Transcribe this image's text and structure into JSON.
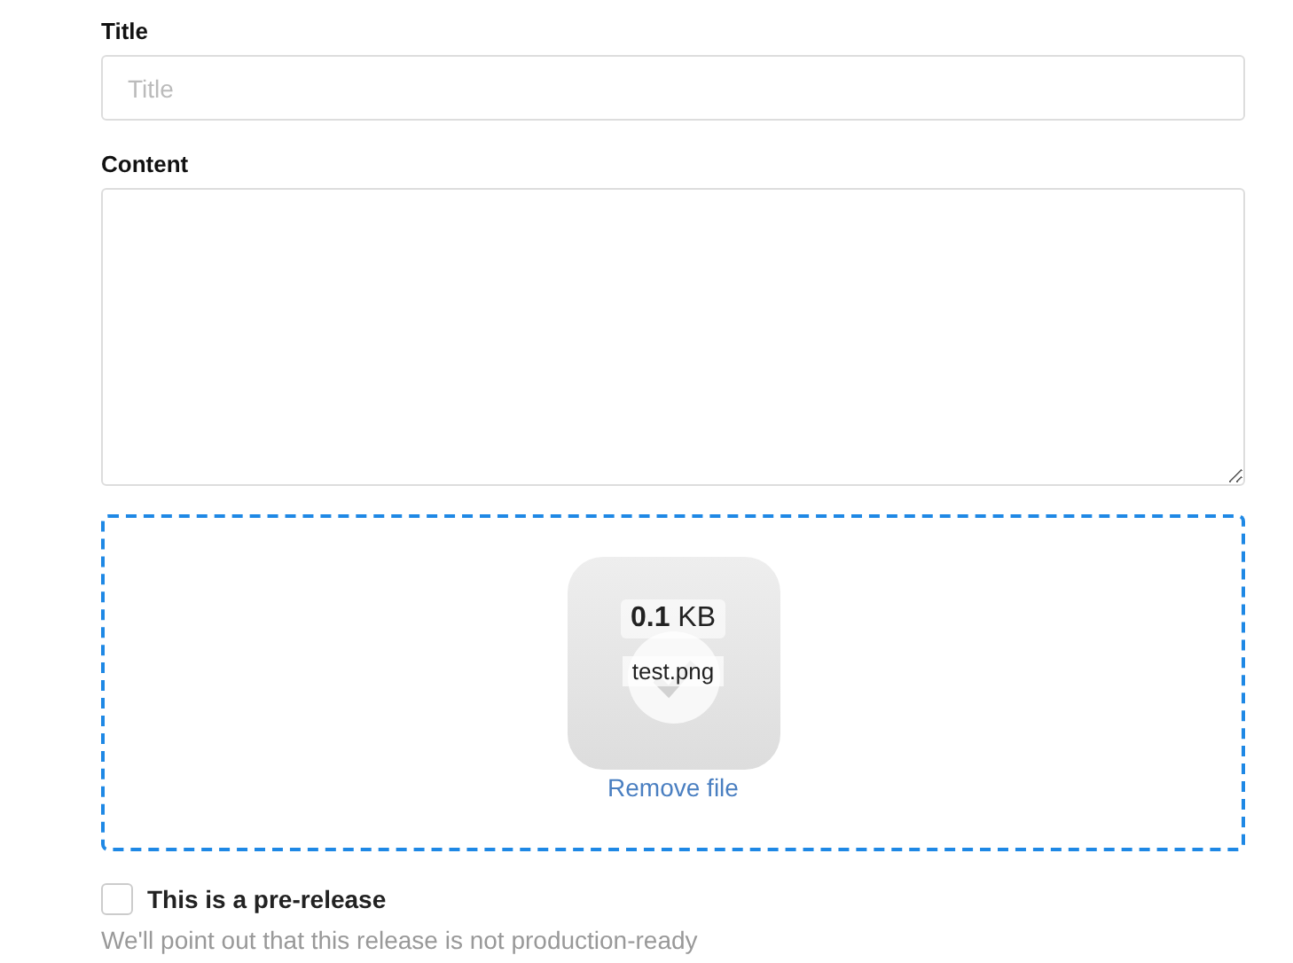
{
  "title_field": {
    "label": "Title",
    "placeholder": "Title"
  },
  "content_field": {
    "label": "Content"
  },
  "dropzone": {
    "file": {
      "size": "**0.1** KB",
      "name": "test.png",
      "uploaded": true
    },
    "remove_link": "Remove file"
  },
  "prerelease": {
    "label": "This is a pre-release",
    "checked": false,
    "hint": "We'll point out that this release is not production-ready"
  }
}
